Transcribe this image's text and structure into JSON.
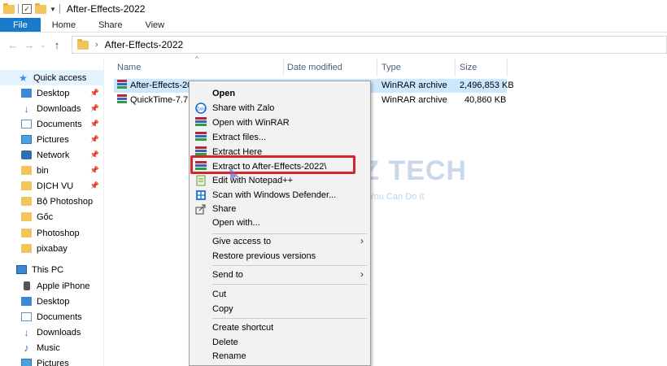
{
  "window": {
    "title": "After-Effects-2022"
  },
  "ribbon": {
    "tabs": [
      "File",
      "Home",
      "Share",
      "View"
    ]
  },
  "address": {
    "crumb": "After-Effects-2022",
    "icons": {
      "back": "back-arrow-icon",
      "forward": "forward-arrow-icon",
      "up": "up-arrow-icon"
    }
  },
  "nav": {
    "items": [
      {
        "label": "Quick access",
        "icon": "star-icon",
        "pinned": false
      },
      {
        "label": "Desktop",
        "icon": "desktop-icon",
        "pinned": true
      },
      {
        "label": "Downloads",
        "icon": "download-icon",
        "pinned": true
      },
      {
        "label": "Documents",
        "icon": "document-icon",
        "pinned": true
      },
      {
        "label": "Pictures",
        "icon": "pictures-icon",
        "pinned": true
      },
      {
        "label": "Network",
        "icon": "network-icon",
        "pinned": true
      },
      {
        "label": "bin",
        "icon": "folder-icon",
        "pinned": true
      },
      {
        "label": "DỊCH VỤ",
        "icon": "folder-icon",
        "pinned": true
      },
      {
        "label": "Bộ Photoshop",
        "icon": "folder-icon",
        "pinned": false
      },
      {
        "label": "Gốc",
        "icon": "folder-icon",
        "pinned": false
      },
      {
        "label": "Photoshop",
        "icon": "folder-icon",
        "pinned": false
      },
      {
        "label": "pixabay",
        "icon": "folder-icon",
        "pinned": false
      },
      {
        "label": "This PC",
        "icon": "pc-icon",
        "pinned": false
      },
      {
        "label": "Apple iPhone",
        "icon": "phone-icon",
        "pinned": false
      },
      {
        "label": "Desktop",
        "icon": "desktop-icon",
        "pinned": false
      },
      {
        "label": "Documents",
        "icon": "document-icon",
        "pinned": false
      },
      {
        "label": "Downloads",
        "icon": "download-icon",
        "pinned": false
      },
      {
        "label": "Music",
        "icon": "music-icon",
        "pinned": false
      },
      {
        "label": "Pictures",
        "icon": "pictures-icon",
        "pinned": false
      }
    ]
  },
  "files": {
    "columns": {
      "name": "Name",
      "date": "Date modified",
      "type": "Type",
      "size": "Size"
    },
    "rows": [
      {
        "name": "After-Effects-2022",
        "type": "WinRAR archive",
        "size": "2,496,853 KB",
        "selected": true
      },
      {
        "name": "QuickTime-7.7.9.",
        "type": "WinRAR archive",
        "size": "40,860 KB",
        "selected": false
      }
    ]
  },
  "context_menu": {
    "items": [
      {
        "label": "Open",
        "icon": "",
        "bold": true
      },
      {
        "label": "Share with Zalo",
        "icon": "zalo-icon"
      },
      {
        "label": "Open with WinRAR",
        "icon": "winrar-icon"
      },
      {
        "label": "Extract files...",
        "icon": "winrar-icon"
      },
      {
        "label": "Extract Here",
        "icon": "winrar-icon"
      },
      {
        "label": "Extract to After-Effects-2022\\",
        "icon": "winrar-icon",
        "highlighted": true
      },
      {
        "label": "Edit with Notepad++",
        "icon": "notepad-icon"
      },
      {
        "label": "Scan with Windows Defender...",
        "icon": "defender-icon"
      },
      {
        "label": "Share",
        "icon": "share-icon"
      },
      {
        "label": "Open with...",
        "icon": ""
      },
      {
        "label": "Give access to",
        "icon": "",
        "submenu": true
      },
      {
        "label": "Restore previous versions",
        "icon": ""
      },
      {
        "label": "Send to",
        "icon": "",
        "submenu": true
      },
      {
        "label": "Cut",
        "icon": ""
      },
      {
        "label": "Copy",
        "icon": ""
      },
      {
        "label": "Create shortcut",
        "icon": ""
      },
      {
        "label": "Delete",
        "icon": ""
      },
      {
        "label": "Rename",
        "icon": ""
      }
    ]
  },
  "watermark": {
    "brand": "DEZ TECH",
    "slogan": "I Can Do It You Can Do It"
  },
  "colors": {
    "accent": "#1979ca",
    "selection": "#cce8ff",
    "highlight_box": "#d7262a"
  }
}
